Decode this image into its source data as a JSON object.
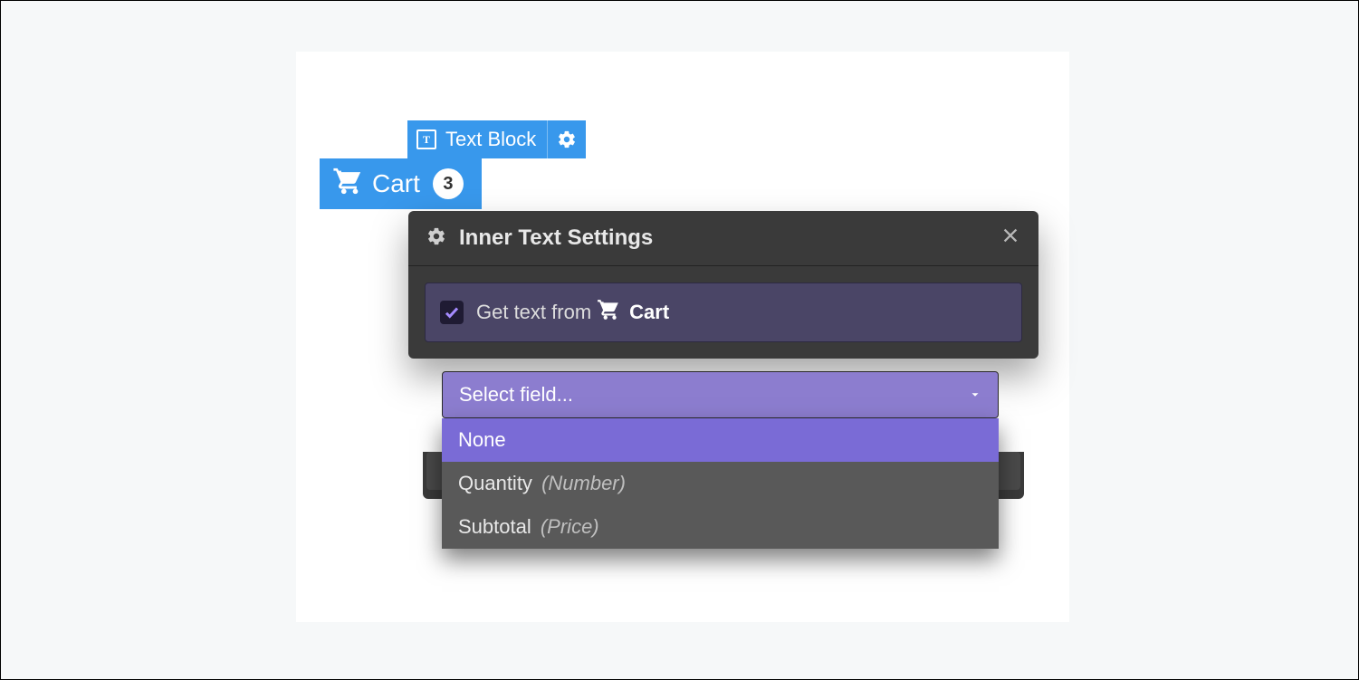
{
  "block_label": "Text Block",
  "cart": {
    "label": "Cart",
    "count": "3"
  },
  "panel": {
    "title": "Inner Text Settings",
    "checkbox_label": "Get text from",
    "source_name": "Cart",
    "select_placeholder": "Select field...",
    "options": [
      {
        "label": "None",
        "hint": ""
      },
      {
        "label": "Quantity",
        "hint": "(Number)"
      },
      {
        "label": "Subtotal",
        "hint": "(Price)"
      }
    ]
  },
  "colors": {
    "blue": "#3898ec",
    "panel": "#3a3a3a",
    "purple": "#7a6bd6",
    "purple_light": "#8c7dcf"
  }
}
